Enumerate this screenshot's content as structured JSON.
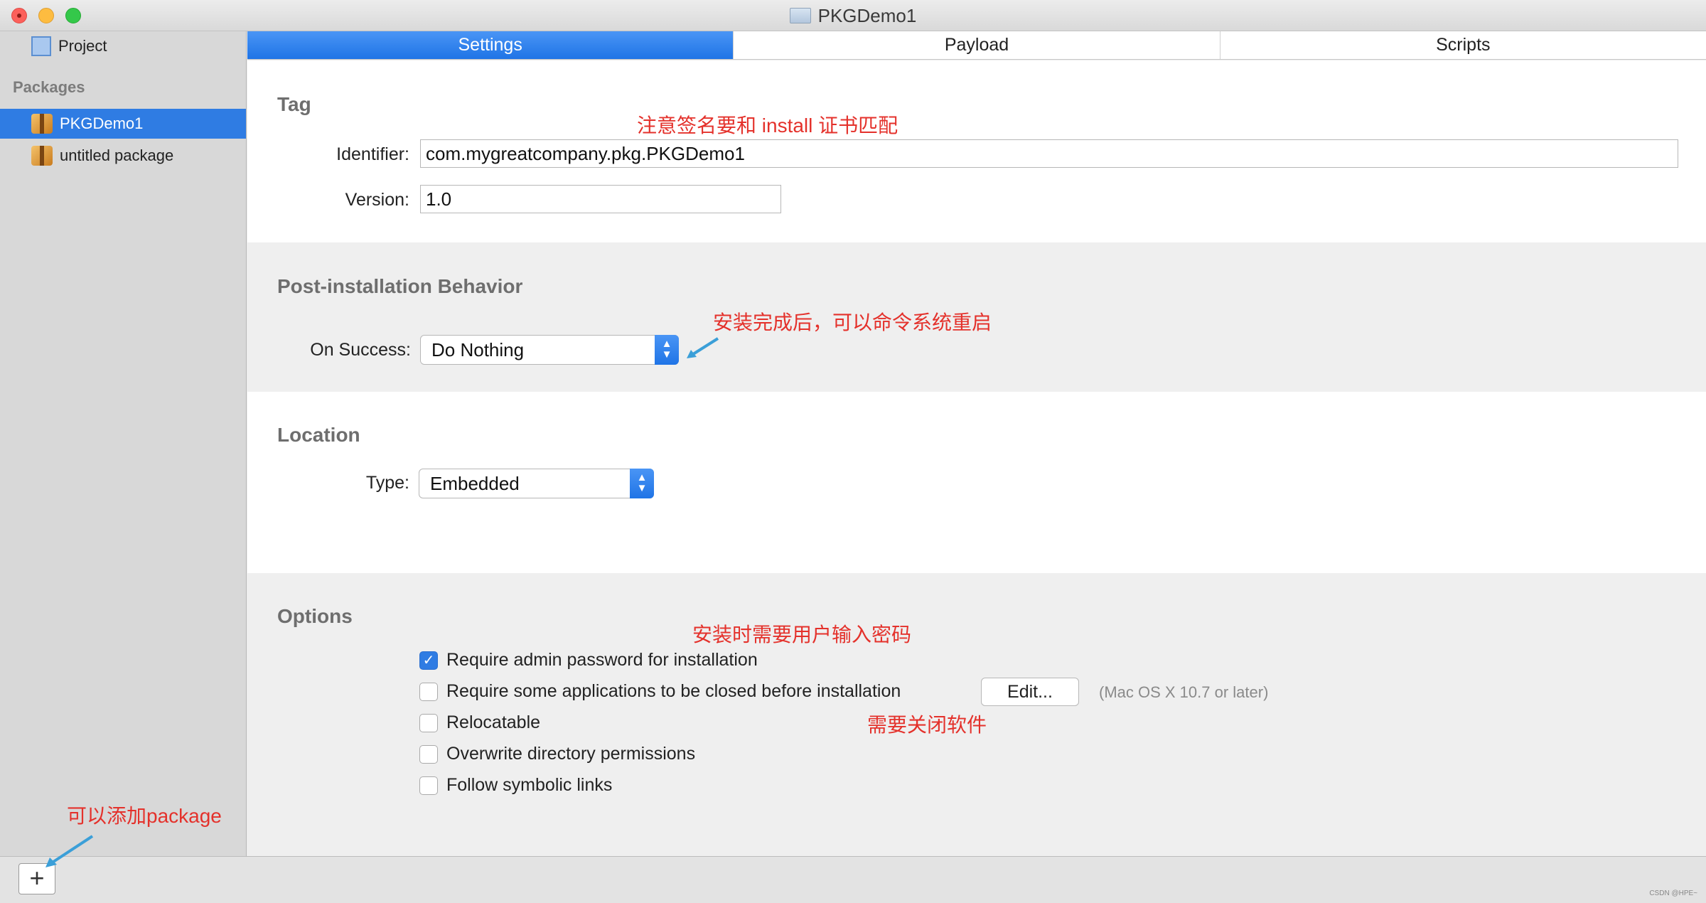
{
  "window": {
    "title": "PKGDemo1"
  },
  "sidebar": {
    "project_label": "Project",
    "packages_header": "Packages",
    "packages": [
      {
        "label": "PKGDemo1",
        "selected": true
      },
      {
        "label": "untitled package",
        "selected": false
      }
    ],
    "add_button": "+"
  },
  "tabs": [
    {
      "label": "Settings",
      "active": true
    },
    {
      "label": "Payload",
      "active": false
    },
    {
      "label": "Scripts",
      "active": false
    }
  ],
  "tag": {
    "header": "Tag",
    "identifier_label": "Identifier:",
    "identifier_value": "com.mygreatcompany.pkg.PKGDemo1",
    "version_label": "Version:",
    "version_value": "1.0"
  },
  "post_install": {
    "header": "Post-installation Behavior",
    "on_success_label": "On Success:",
    "on_success_value": "Do Nothing"
  },
  "location": {
    "header": "Location",
    "type_label": "Type:",
    "type_value": "Embedded"
  },
  "options": {
    "header": "Options",
    "items": [
      {
        "label": "Require admin password for installation",
        "checked": true
      },
      {
        "label": "Require some applications to be closed before installation",
        "checked": false
      },
      {
        "label": "Relocatable",
        "checked": false
      },
      {
        "label": "Overwrite directory permissions",
        "checked": false
      },
      {
        "label": "Follow symbolic links",
        "checked": false
      }
    ],
    "edit_button": "Edit...",
    "edit_hint": "(Mac OS X 10.7 or later)"
  },
  "annotations": {
    "signature": "注意签名要和 install 证书匹配",
    "restart": "安装完成后，可以命令系统重启",
    "password": "安装时需要用户输入密码",
    "close_apps": "需要关闭软件",
    "add_package": "可以添加package"
  },
  "colors": {
    "accent": "#2f7ce3",
    "annotation": "#e4312b",
    "arrow": "#3b9fd8"
  },
  "watermark": "CSDN @HPE~"
}
